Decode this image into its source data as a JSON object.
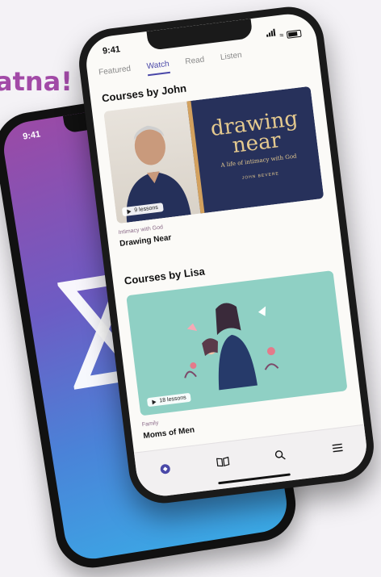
{
  "headline": "atna!",
  "back_phone": {
    "time": "9:41",
    "gradient_colors": [
      "#9b4aa6",
      "#6d5cc4",
      "#4a83d8",
      "#3aaae6"
    ]
  },
  "front_phone": {
    "time": "9:41",
    "tabs": [
      {
        "label": "Featured",
        "active": false
      },
      {
        "label": "Watch",
        "active": true
      },
      {
        "label": "Read",
        "active": false
      },
      {
        "label": "Listen",
        "active": false
      }
    ],
    "sections": [
      {
        "title": "Courses by John",
        "course": {
          "cover_title": "drawing near",
          "cover_subtitle": "A life of intimacy with God",
          "cover_author": "JOHN BEVERE",
          "lessons": "9 lessons",
          "category": "Intimacy with God",
          "title": "Drawing Near"
        }
      },
      {
        "title": "Courses by Lisa",
        "course": {
          "lessons": "18 lessons",
          "category": "Family",
          "title": "Moms of Men"
        }
      }
    ],
    "bottom_nav": [
      {
        "icon": "compass-icon",
        "active": true
      },
      {
        "icon": "book-icon",
        "active": false
      },
      {
        "icon": "search-icon",
        "active": false
      },
      {
        "icon": "menu-icon",
        "active": false
      }
    ],
    "accent": "#4a48a8"
  }
}
